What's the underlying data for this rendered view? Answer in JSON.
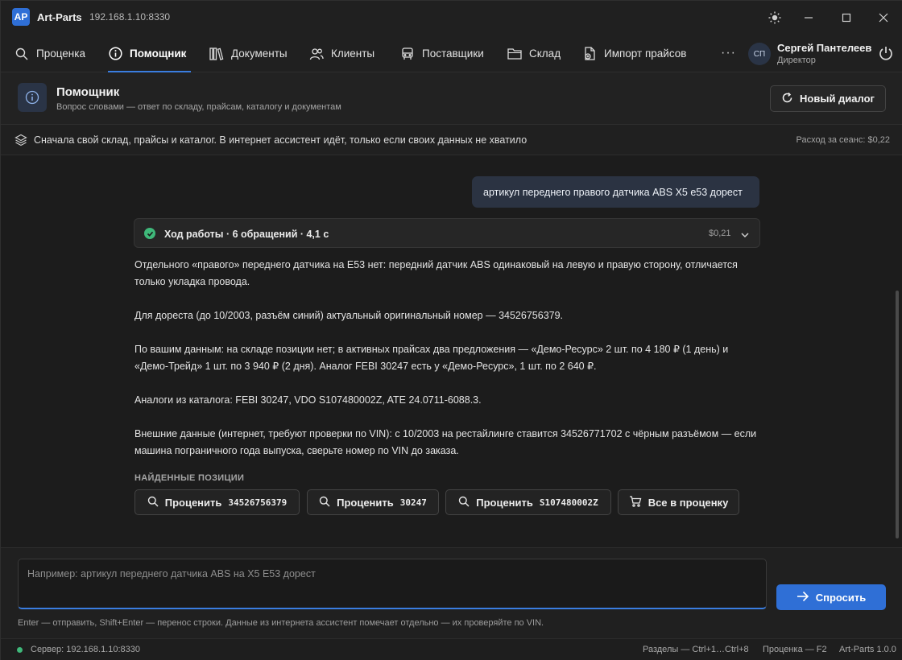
{
  "app": {
    "logo": "AP",
    "name": "Art-Parts",
    "host": "192.168.1.10:8330"
  },
  "nav": {
    "items": [
      {
        "label": "Проценка",
        "icon": "search-icon"
      },
      {
        "label": "Помощник",
        "icon": "info-icon",
        "active": true
      },
      {
        "label": "Документы",
        "icon": "books-icon"
      },
      {
        "label": "Клиенты",
        "icon": "users-icon"
      },
      {
        "label": "Поставщики",
        "icon": "truck-icon"
      },
      {
        "label": "Склад",
        "icon": "folder-icon"
      },
      {
        "label": "Импорт прайсов",
        "icon": "file-import-icon"
      }
    ],
    "more": "···"
  },
  "user": {
    "initials": "СП",
    "name": "Сергей Пантелеев",
    "role": "Директор"
  },
  "header": {
    "title": "Помощник",
    "subtitle": "Вопрос словами — ответ по складу, прайсам, каталогу и документам",
    "new_dialog": "Новый диалог"
  },
  "info": {
    "text": "Сначала свой склад, прайсы и каталог. В интернет ассистент идёт, только если своих данных не хватило",
    "cost": "Расход за сеанс: $0,22"
  },
  "chat": {
    "user_message": "артикул переднего правого датчика ABS X5 e53 дорест",
    "progress_label": "Ход работы · 6 обращений · 4,1 с",
    "progress_cost": "$0,21",
    "answer": [
      "Отдельного «правого» переднего датчика на E53 нет: передний датчик ABS одинаковый на левую и правую сторону, отличается только укладка провода.",
      "Для дореста (до 10/2003, разъём синий) актуальный оригинальный номер — 34526756379.",
      "По вашим данным: на складе позиции нет; в активных прайсах два предложения — «Демо-Ресурс» 2 шт. по 4 180 ₽ (1 день) и «Демо-Трейд» 1 шт. по 3 940 ₽ (2 дня). Аналог FEBI 30247 есть у «Демо-Ресурс», 1 шт. по 2 640 ₽.",
      "Аналоги из каталога: FEBI 30247, VDO S107480002Z, ATE 24.0711-6088.3.",
      "Внешние данные (интернет, требуют проверки по VIN): с 10/2003 на рестайлинге ставится 34526771702 с чёрным разъёмом — если машина пограничного года выпуска, сверьте номер по VIN до заказа."
    ],
    "found_label": "НАЙДЕННЫЕ ПОЗИЦИИ",
    "positions": [
      {
        "label": "Проценить",
        "code": "34526756379"
      },
      {
        "label": "Проценить",
        "code": "30247"
      },
      {
        "label": "Проценить",
        "code": "S107480002Z"
      }
    ],
    "all_to_quote": "Все в проценку"
  },
  "input": {
    "placeholder": "Например: артикул переднего датчика ABS на X5 E53 дорест",
    "value": "",
    "ask": "Спросить",
    "hint": "Enter — отправить, Shift+Enter — перенос строки. Данные из интернета ассистент помечает отдельно — их проверяйте по VIN."
  },
  "status": {
    "server": "Сервер: 192.168.1.10:8330",
    "sections_hint": "Разделы — Ctrl+1…Ctrl+8",
    "quote_hint": "Проценка — F2",
    "version": "Art-Parts 1.0.0"
  },
  "colors": {
    "accent": "#2f6fd6",
    "success": "#3fb87a",
    "background": "#1c1c1c"
  }
}
